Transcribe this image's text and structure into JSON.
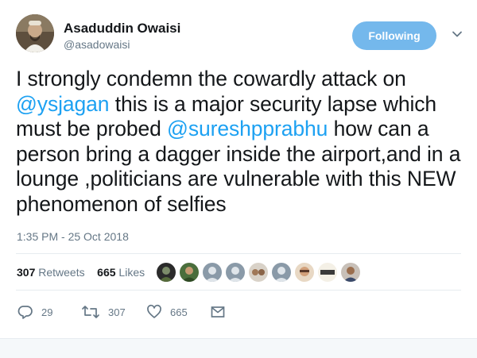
{
  "author": {
    "name": "Asaduddin Owaisi",
    "handle": "@asadowaisi"
  },
  "follow_button": {
    "label": "Following"
  },
  "tweet": {
    "segments": [
      {
        "text": "I strongly condemn the cowardly attack on ",
        "type": "text"
      },
      {
        "text": "@ysjagan",
        "type": "mention"
      },
      {
        "text": " this is a major security lapse which must be probed ",
        "type": "text"
      },
      {
        "text": "@sureshpprabhu",
        "type": "mention"
      },
      {
        "text": " how can a person bring a dagger inside the airport,and in a lounge ,politicians are vulnerable with this NEW phenomenon of selfies",
        "type": "text"
      }
    ],
    "timestamp": "1:35 PM - 25 Oct 2018"
  },
  "stats": {
    "retweets_count": "307",
    "retweets_label": "Retweets",
    "likes_count": "665",
    "likes_label": "Likes"
  },
  "likers_count": 10,
  "actions": {
    "reply_count": "29",
    "retweet_count": "307",
    "like_count": "665"
  },
  "colors": {
    "accent": "#1da1f2",
    "follow_button_bg": "#74b8ec",
    "secondary_text": "#657786"
  },
  "icons": [
    "reply-icon",
    "retweet-icon",
    "heart-icon",
    "mail-icon",
    "chevron-down-icon"
  ]
}
